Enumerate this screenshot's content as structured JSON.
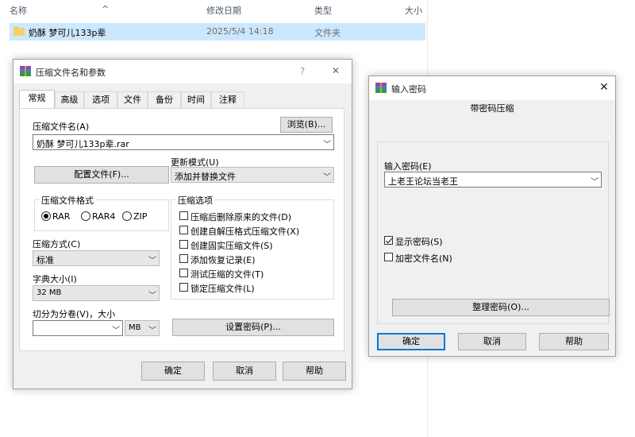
{
  "explorer": {
    "columns": {
      "name": "名称",
      "modified": "修改日期",
      "type": "类型",
      "size": "大小"
    },
    "sort_indicator": "^",
    "rows": [
      {
        "name": "奶酥 梦可儿133p辈",
        "modified": "2025/5/4 14:18",
        "type": "文件夹",
        "icon": "folder-icon"
      }
    ]
  },
  "archive_dialog": {
    "title": "压缩文件名和参数",
    "help_glyph": "?",
    "close_glyph": "✕",
    "tabs": [
      "常规",
      "高级",
      "选项",
      "文件",
      "备份",
      "时间",
      "注释"
    ],
    "active_tab": "常规",
    "archive_name_label": "压缩文件名(A)",
    "browse_button": "浏览(B)...",
    "archive_name_value": "奶酥 梦可儿133p辈.rar",
    "profiles_button": "配置文件(F)...",
    "update_mode_label": "更新模式(U)",
    "update_mode_value": "添加并替换文件",
    "format_group": {
      "title": "压缩文件格式",
      "options": [
        "RAR",
        "RAR4",
        "ZIP"
      ],
      "selected": "RAR"
    },
    "method_label": "压缩方式(C)",
    "method_value": "标准",
    "dict_label": "字典大小(I)",
    "dict_value": "32 MB",
    "split_label": "切分为分卷(V)，大小",
    "split_value": "",
    "split_unit": "MB",
    "options_group": {
      "title": "压缩选项",
      "items": [
        {
          "label": "压缩后删除原来的文件(D)",
          "checked": false
        },
        {
          "label": "创建自解压格式压缩文件(X)",
          "checked": false
        },
        {
          "label": "创建固实压缩文件(S)",
          "checked": false
        },
        {
          "label": "添加恢复记录(E)",
          "checked": false
        },
        {
          "label": "测试压缩的文件(T)",
          "checked": false
        },
        {
          "label": "锁定压缩文件(L)",
          "checked": false
        }
      ]
    },
    "set_password_button": "设置密码(P)...",
    "ok_button": "确定",
    "cancel_button": "取消",
    "help_button": "帮助"
  },
  "password_dialog": {
    "title": "输入密码",
    "close_glyph": "✕",
    "header": "带密码压缩",
    "password_label": "输入密码(E)",
    "password_value": "上老王论坛当老王",
    "show_password": {
      "label": "显示密码(S)",
      "checked": true
    },
    "encrypt_names": {
      "label": "加密文件名(N)",
      "checked": false
    },
    "organize_button": "整理密码(O)...",
    "ok_button": "确定",
    "cancel_button": "取消",
    "help_button": "帮助"
  },
  "colors": {
    "selection": "#cce8ff",
    "dialog_bg": "#f0f0f0",
    "primary_border": "#0078d7"
  }
}
